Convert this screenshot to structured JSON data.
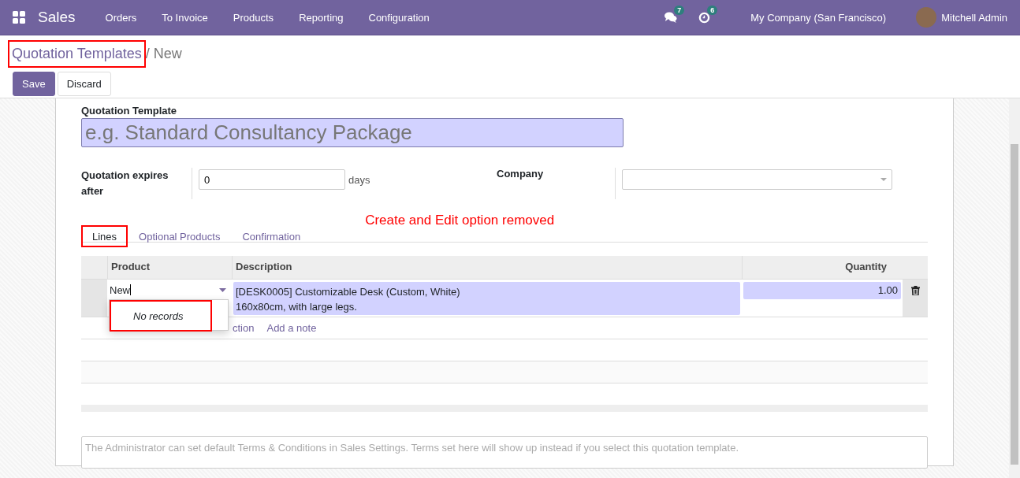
{
  "navbar": {
    "app_name": "Sales",
    "menu": [
      "Orders",
      "To Invoice",
      "Products",
      "Reporting",
      "Configuration"
    ],
    "messages_count": "7",
    "activities_count": "6",
    "company": "My Company (San Francisco)",
    "user": "Mitchell Admin"
  },
  "breadcrumb": {
    "parent": "Quotation Templates",
    "current": "/ New",
    "highlighted": true
  },
  "buttons": {
    "save": "Save",
    "discard": "Discard"
  },
  "form": {
    "name_label": "Quotation Template",
    "name_placeholder": "e.g. Standard Consultancy Package",
    "expires_label": "Quotation expires after",
    "expires_value": "0",
    "expires_unit": "days",
    "company_label": "Company"
  },
  "annotation": "Create and Edit option removed",
  "tabs": [
    {
      "label": "Lines",
      "selected": true,
      "highlighted": true
    },
    {
      "label": "Optional Products",
      "selected": false,
      "highlighted": false
    },
    {
      "label": "Confirmation",
      "selected": false,
      "highlighted": false
    }
  ],
  "table": {
    "columns": [
      "Product",
      "Description",
      "Quantity"
    ],
    "rows": [
      {
        "product": "New",
        "description": "[DESK0005] Customizable Desk (Custom, White)\n160x80cm, with large legs.",
        "quantity": "1.00"
      }
    ],
    "add_links": [
      "ction",
      "Add a note"
    ]
  },
  "dropdown": {
    "message": "No records",
    "highlighted": true
  },
  "terms_placeholder": "The Administrator can set default Terms & Conditions in Sales Settings. Terms set here will show up instead if you select this quotation template."
}
